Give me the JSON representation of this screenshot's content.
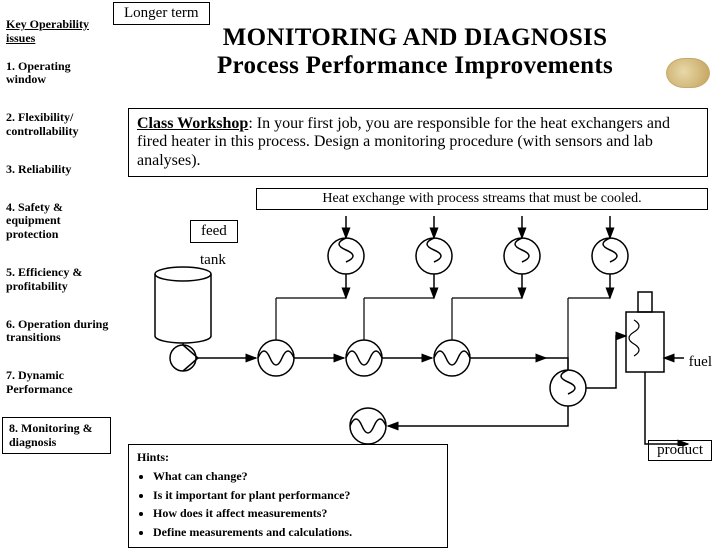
{
  "topbox": "Longer term",
  "sidebar": {
    "heading": "Key Operability issues",
    "items": [
      "1. Operating window",
      "2. Flexibility/ controllability",
      "3. Reliability",
      "4. Safety & equipment protection",
      "5. Efficiency & profitability",
      "6. Operation during transitions",
      "7. Dynamic Performance",
      "8. Monitoring & diagnosis"
    ],
    "selected_index": 7
  },
  "title": {
    "line1": "MONITORING AND DIAGNOSIS",
    "line2": "Process Performance Improvements"
  },
  "workshop": {
    "lead": "Class Workshop",
    "body": ":  In your first job, you are responsible for the heat exchangers and fired heater in this process.  Design a monitoring procedure (with sensors and lab analyses)."
  },
  "hx_caption": "Heat exchange with process streams that must be cooled.",
  "diagram": {
    "feed": "feed",
    "tank": "tank",
    "fuel": "fuel",
    "product": "product"
  },
  "hints": {
    "title": "Hints:",
    "items": [
      "What can change?",
      "Is it important for plant performance?",
      "How does it affect measurements?",
      "Define measurements and calculations."
    ]
  }
}
